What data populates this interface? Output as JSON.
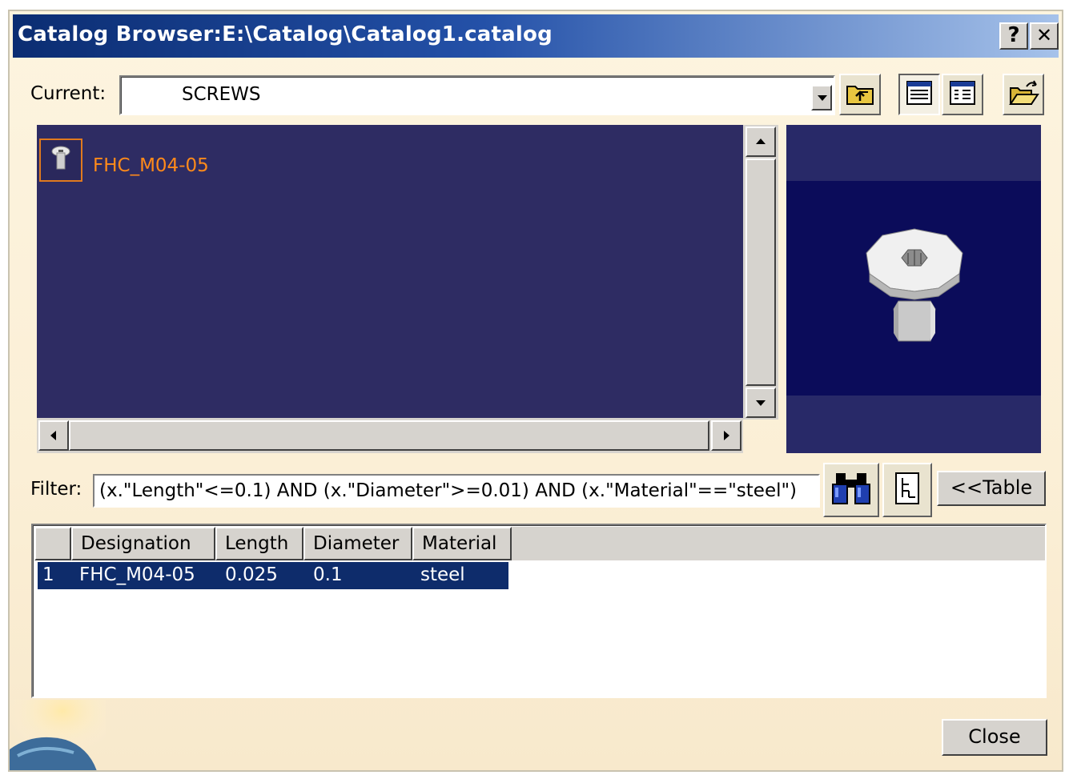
{
  "window": {
    "title": "Catalog Browser:E:\\Catalog\\Catalog1.catalog",
    "help_label": "?",
    "close_label": "✕"
  },
  "current": {
    "label": "Current:",
    "value": "SCREWS"
  },
  "toolbar": {
    "icons": [
      "parent-folder-icon",
      "list-view-icon",
      "details-view-icon",
      "open-folder-icon"
    ]
  },
  "viewer": {
    "item_label": "FHC_M04-05",
    "item_icon": "screw-icon",
    "label_color": "#ff8a1a",
    "background": "#2e2c63"
  },
  "filter": {
    "label": "Filter:",
    "value": "(x.\"Length\"<=0.1) AND (x.\"Diameter\">=0.01) AND (x.\"Material\"==\"steel\")",
    "search_icon": "binoculars-icon",
    "formula_icon": "formula-editor-icon",
    "table_button": "<<Table"
  },
  "table": {
    "columns": [
      "",
      "Designation",
      "Length",
      "Diameter",
      "Material"
    ],
    "rows": [
      {
        "index": "1",
        "designation": "FHC_M04-05",
        "length": "0.025",
        "diameter": "0.1",
        "material": "steel"
      }
    ],
    "selection_color": "#0e2c6b"
  },
  "footer": {
    "close_button": "Close"
  }
}
